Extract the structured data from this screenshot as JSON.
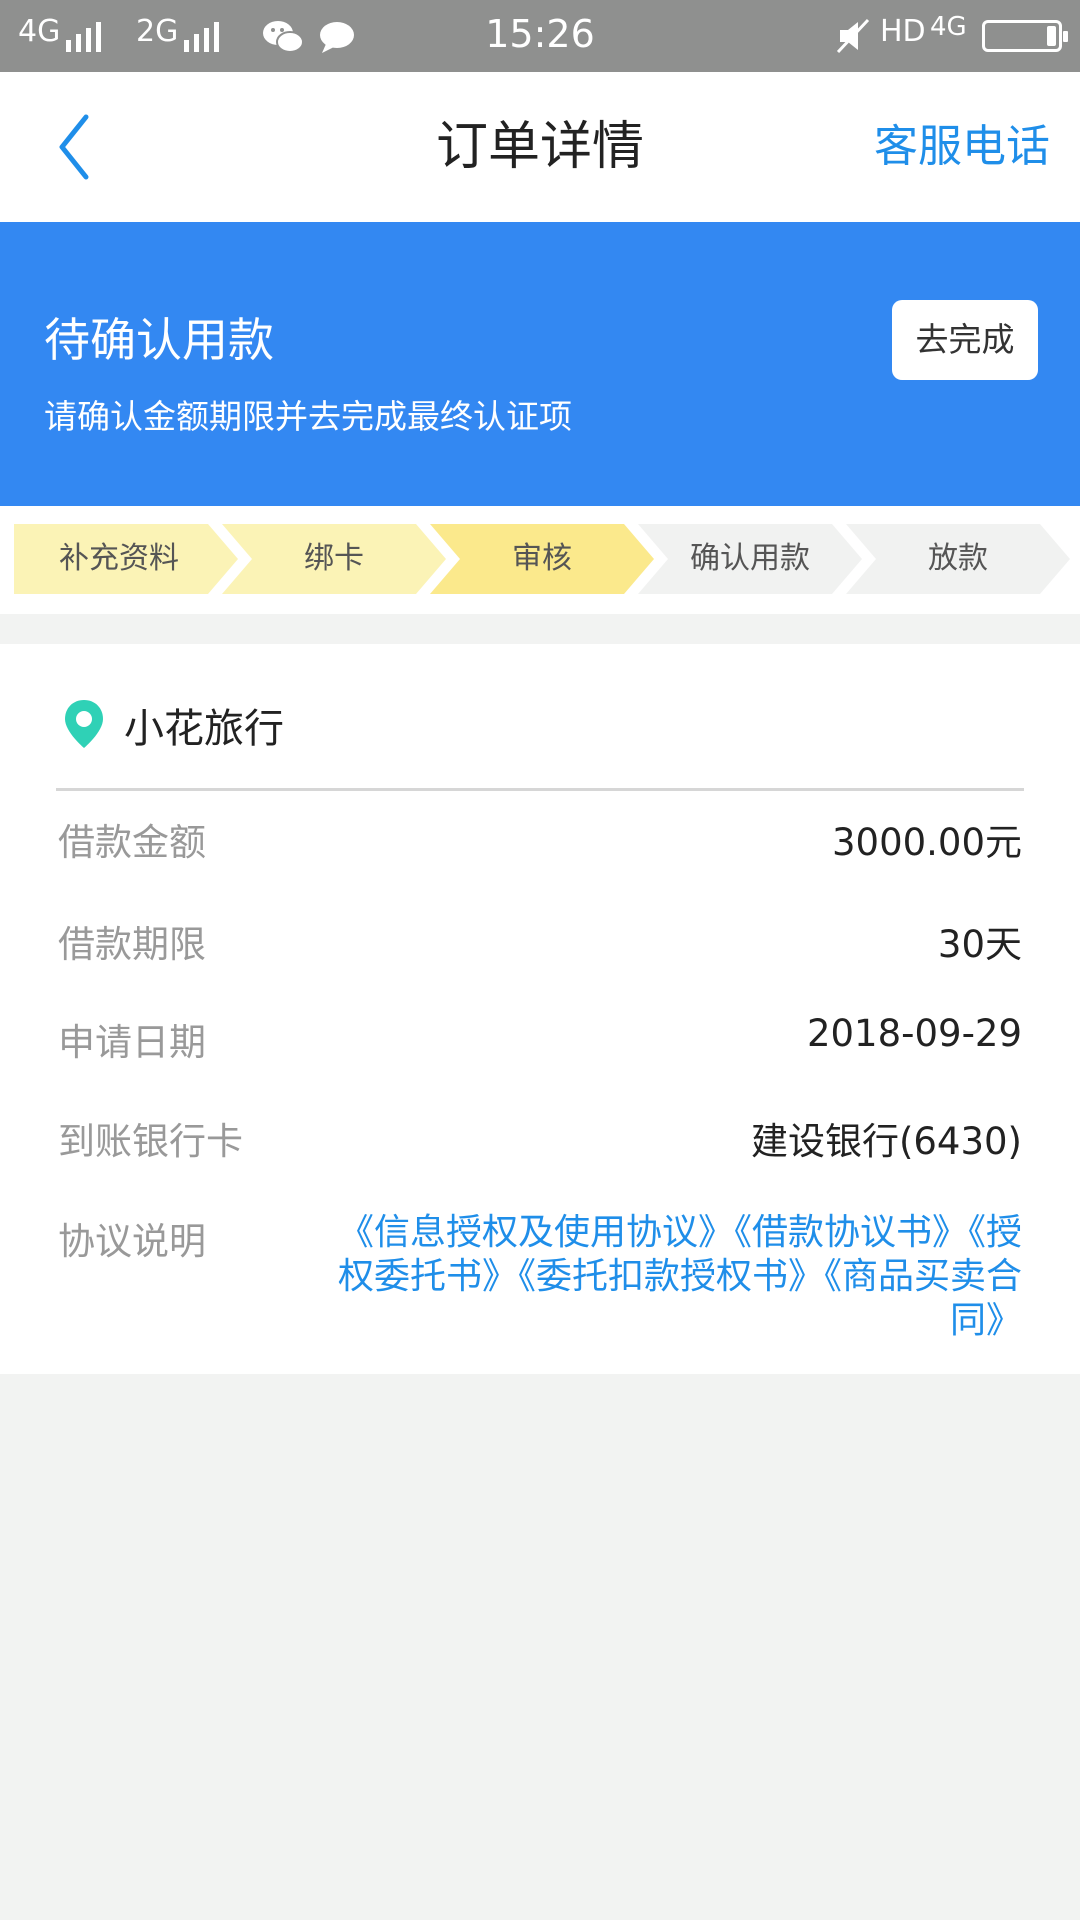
{
  "status_bar": {
    "net1": "4G",
    "net2": "2G",
    "time": "15:26",
    "hd": "HD",
    "net3": "4G"
  },
  "header": {
    "title": "订单详情",
    "right_link": "客服电话"
  },
  "banner": {
    "title": "待确认用款",
    "subtitle": "请确认金额期限并去完成最终认证项",
    "button_label": "去完成"
  },
  "steps": [
    {
      "label": "补充资料",
      "color": "#fbf3b6"
    },
    {
      "label": "绑卡",
      "color": "#fbf3b6"
    },
    {
      "label": "审核",
      "color": "#fbe98c"
    },
    {
      "label": "确认用款",
      "color": "#f1f2f1"
    },
    {
      "label": "放款",
      "color": "#f1f2f1"
    }
  ],
  "merchant": {
    "name": "小花旅行",
    "icon": "location-pin-icon",
    "icon_color": "#2fd1b6"
  },
  "details": [
    {
      "label": "借款金额",
      "value": "3000.00元"
    },
    {
      "label": "借款期限",
      "value": "30天"
    },
    {
      "label": "申请日期",
      "value": "2018-09-29"
    },
    {
      "label": "到账银行卡",
      "value": "建设银行(6430)"
    }
  ],
  "agreement": {
    "label": "协议说明",
    "items": [
      "《信息授权及使用协议》",
      "《借款协议书》",
      "《授权委托书》",
      "《委托扣款授权书》",
      "《商品买卖合同》"
    ]
  },
  "colors": {
    "accent": "#1f8ee9",
    "banner": "#3388f2"
  }
}
